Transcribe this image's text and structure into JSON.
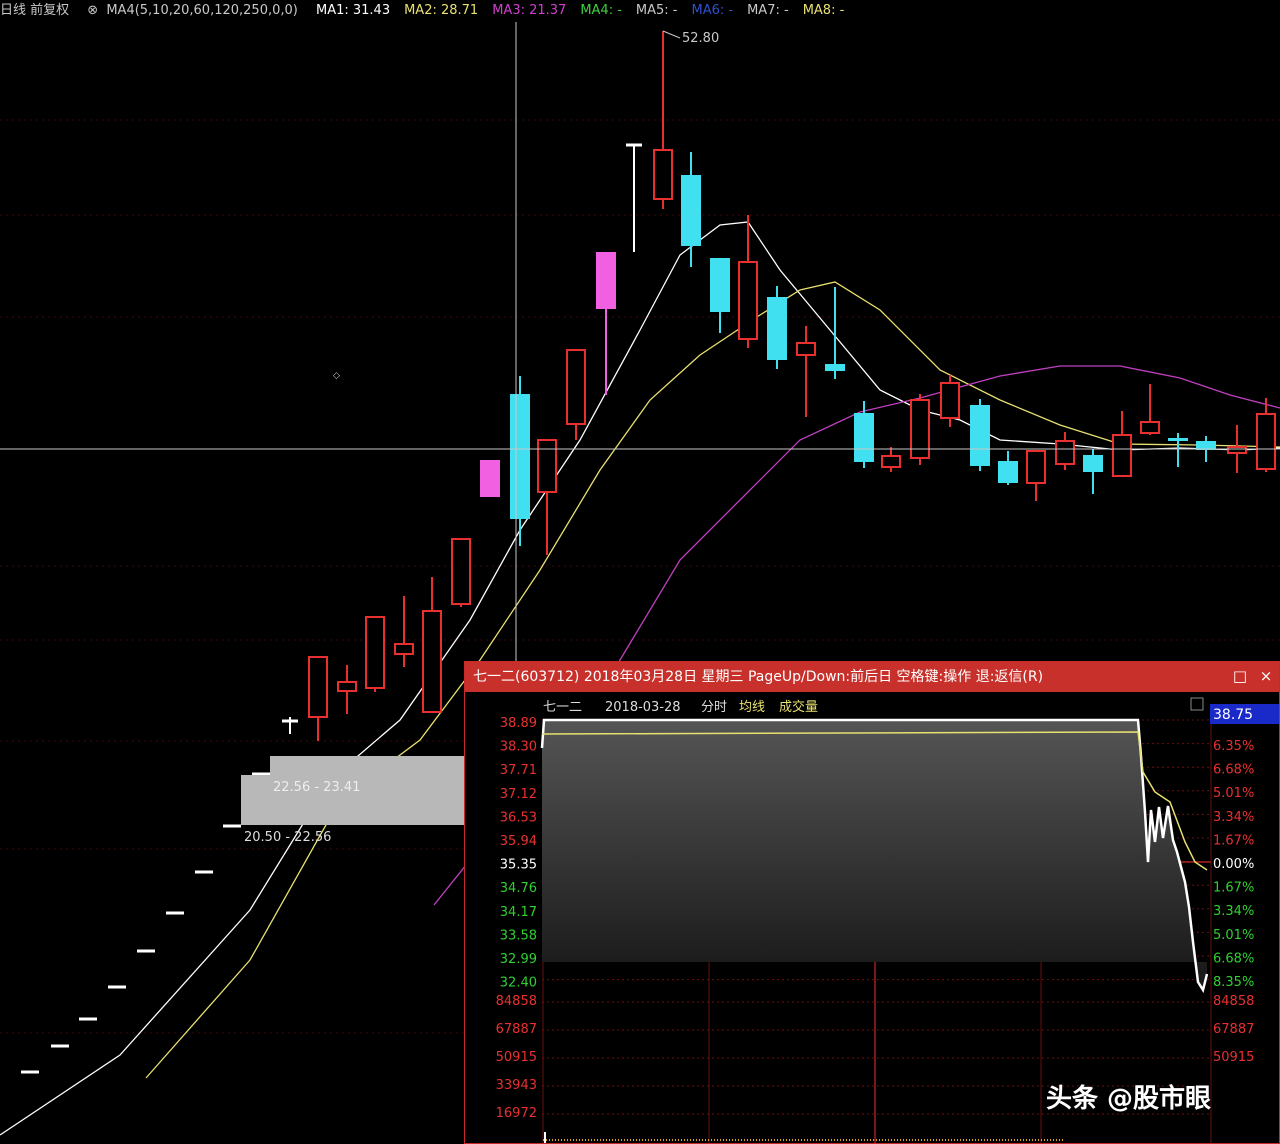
{
  "legend": {
    "title": "日线 前复权",
    "ma_config": "MA4(5,10,20,60,120,250,0,0)",
    "items": [
      {
        "label": "MA1: 31.43",
        "color": "#ffffff"
      },
      {
        "label": "MA2: 28.71",
        "color": "#e8e070"
      },
      {
        "label": "MA3: 21.37",
        "color": "#d040d0"
      },
      {
        "label": "MA4: -",
        "color": "#40d040"
      },
      {
        "label": "MA5: -",
        "color": "#c8c8c8"
      },
      {
        "label": "MA6: -",
        "color": "#3050d0"
      },
      {
        "label": "MA7: -",
        "color": "#c8c8c8"
      },
      {
        "label": "MA8: -",
        "color": "#e8e070"
      }
    ]
  },
  "price_labels": {
    "high": "52.80",
    "range_1": "22.56 - 23.41",
    "range_2": "20.50 - 22.56"
  },
  "popup": {
    "title": "七一二(603712) 2018年03月28日 星期三 PageUp/Down:前后日 空格键:操作 退:返信(R)",
    "max_icon": "□",
    "close_icon": "×",
    "header": {
      "name": "七一二",
      "date": "2018-03-28",
      "mode": "分时",
      "avg_label": "均线",
      "vol_label": "成交量",
      "current_price": "38.75"
    },
    "price_axis": [
      "38.89",
      "38.30",
      "37.71",
      "37.12",
      "36.53",
      "35.94",
      "35.35",
      "34.76",
      "34.17",
      "33.58",
      "32.99",
      "32.40"
    ],
    "pct_axis": [
      "6.35%",
      "6.68%",
      "5.01%",
      "3.34%",
      "1.67%",
      "0.00%",
      "1.67%",
      "3.34%",
      "5.01%",
      "6.68%",
      "8.35%"
    ],
    "vol_axis_left": [
      "84858",
      "67887",
      "50915",
      "33943",
      "16972"
    ],
    "vol_axis_right": [
      "84858",
      "67887",
      "50915"
    ]
  },
  "colors": {
    "up": "#e83030",
    "down": "#40e0f0",
    "limit_up": "#f060e0",
    "ma1": "#ffffff",
    "ma2": "#e8e070",
    "ma3": "#c040c0",
    "grid_red": "#6a1010"
  },
  "watermark": "头条 @股市眼"
}
